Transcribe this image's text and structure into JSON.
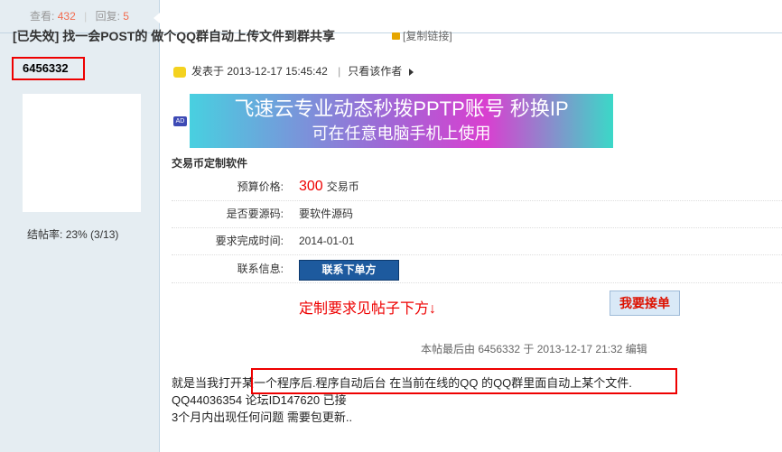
{
  "left": {
    "views_label": "查看:",
    "views": "432",
    "replies_label": "回复:",
    "replies": "5",
    "author": "6456332",
    "close_rate_label": "结帖率:",
    "close_rate": "23% (3/13)"
  },
  "thread": {
    "title": "[已失效] 找一会POST的 做个QQ群自动上传文件到群共享",
    "copy_link": "[复制链接]",
    "posted_on_label": "发表于",
    "posted_on": "2013-12-17 15:45:42",
    "only_author": "只看该作者"
  },
  "ad": {
    "badge": "AD",
    "line1": "飞速云专业动态秒拨PPTP账号  秒换IP",
    "line2": "可在任意电脑手机上使用"
  },
  "trade": {
    "section_title": "交易币定制软件",
    "budget_label": "预算价格:",
    "budget_value": "300",
    "budget_unit": "交易币",
    "source_label": "是否要源码:",
    "source_value": "要软件源码",
    "deadline_label": "要求完成时间:",
    "deadline_value": "2014-01-01",
    "contact_label": "联系信息:",
    "contact_button": "联系下单方",
    "custom_note": "定制要求见帖子下方↓",
    "take_button": "我要接单"
  },
  "last_edit": "本帖最后由 6456332 于 2013-12-17 21:32 编辑",
  "body": {
    "line1_prefix": "就是当我打开",
    "line1_highlight": "某一个程序后.程序自动后台 在当前在线的QQ 的QQ群里面自动上某个文件.",
    "line2": "QQ44036354  论坛ID147620  已接",
    "line3": "3个月内出现任何问题  需要包更新.."
  }
}
